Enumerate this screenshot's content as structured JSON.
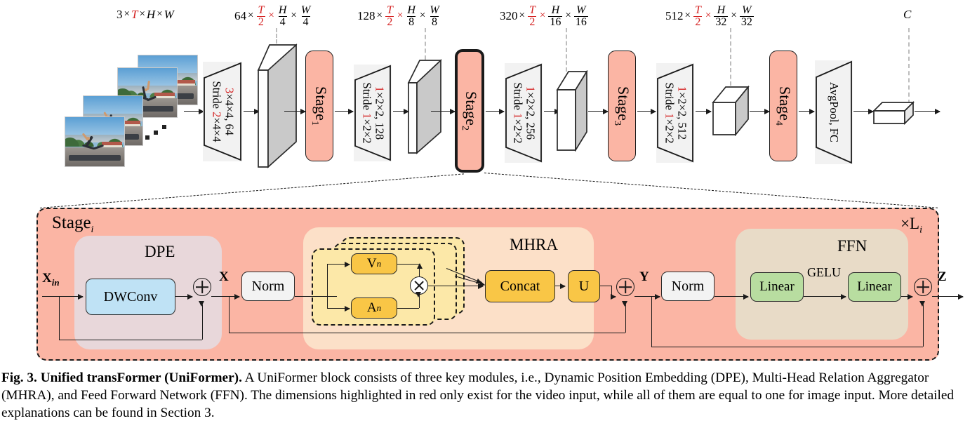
{
  "figure": {
    "id": "Fig. 3.",
    "title": "Unified transFormer (UniFormer).",
    "caption_rest": " A UniFormer block consists of three key modules, i.e., Dynamic Position Embedding (DPE), Multi-Head Relation Aggregator (MHRA), and Feed Forward Network (FFN). The dimensions highlighted in red only exist for the video input, while all of them are equal to one for image input. More detailed explanations can be found in Section 3."
  },
  "colors": {
    "red_highlight": "#d42121",
    "stage_pink": "#fbb5a4",
    "dwconv_blue": "#bfe2f5",
    "mhra_yellow": "#f9c646",
    "mhra_inner_yellow": "#fce8a8",
    "ffn_green": "#b8dda0",
    "dpe_group": "#e8d7da",
    "mhra_group": "#fce0c8",
    "ffn_group": "#e8dbc7",
    "tensor_gray": "#c9c9c9"
  },
  "pipeline": {
    "input_label": {
      "channels": "3",
      "t": "T",
      "h": "H",
      "w": "W",
      "text": "3×T×H×W"
    },
    "dim_labels": [
      {
        "channels": "64",
        "t_num": "T",
        "t_den": "2",
        "h_num": "H",
        "h_den": "4",
        "w_num": "W",
        "w_den": "4"
      },
      {
        "channels": "128",
        "t_num": "T",
        "t_den": "2",
        "h_num": "H",
        "h_den": "8",
        "w_num": "W",
        "w_den": "8"
      },
      {
        "channels": "320",
        "t_num": "T",
        "t_den": "2",
        "h_num": "H",
        "h_den": "16",
        "w_num": "W",
        "w_den": "16"
      },
      {
        "channels": "512",
        "t_num": "T",
        "t_den": "2",
        "h_num": "H",
        "h_den": "32",
        "w_num": "W",
        "w_den": "32"
      }
    ],
    "output_label": "C",
    "conv_blocks": [
      {
        "kernel_red": "3",
        "kernel_rest": "×4×4, 64",
        "stride_pre": "Stride ",
        "stride_red": "2",
        "stride_rest": "×4×4"
      },
      {
        "kernel_red": "1",
        "kernel_rest": "×2×2, 128",
        "stride_pre": "Stride ",
        "stride_red": "1",
        "stride_rest": "×2×2"
      },
      {
        "kernel_red": "1",
        "kernel_rest": "×2×2, 256",
        "stride_pre": "Stride ",
        "stride_red": "1",
        "stride_rest": "×2×2"
      },
      {
        "kernel_red": "1",
        "kernel_rest": "×2×2, 512",
        "stride_pre": "Stride ",
        "stride_red": "1",
        "stride_rest": "×2×2"
      }
    ],
    "head_block": "AvgPool, FC",
    "stages": [
      {
        "label": "Stage",
        "index": "1",
        "highlighted": false
      },
      {
        "label": "Stage",
        "index": "2",
        "highlighted": true
      },
      {
        "label": "Stage",
        "index": "3",
        "highlighted": false
      },
      {
        "label": "Stage",
        "index": "4",
        "highlighted": false
      }
    ]
  },
  "stage_block": {
    "title": "Stage",
    "title_sub": "i",
    "repeat_label": "×L",
    "repeat_sub": "i",
    "groups": {
      "dpe": "DPE",
      "mhra": "MHRA",
      "ffn": "FFN"
    },
    "nodes": {
      "dwconv": "DWConv",
      "norm1": "Norm",
      "v": "V",
      "v_sub": "n",
      "a": "A",
      "a_sub": "n",
      "concat": "Concat",
      "u": "U",
      "norm2": "Norm",
      "linear1": "Linear",
      "linear2": "Linear",
      "gelu": "GELU"
    },
    "tensor_labels": {
      "x_in": "X",
      "x_in_sub": "in",
      "x": "X",
      "y": "Y",
      "z": "Z"
    }
  }
}
